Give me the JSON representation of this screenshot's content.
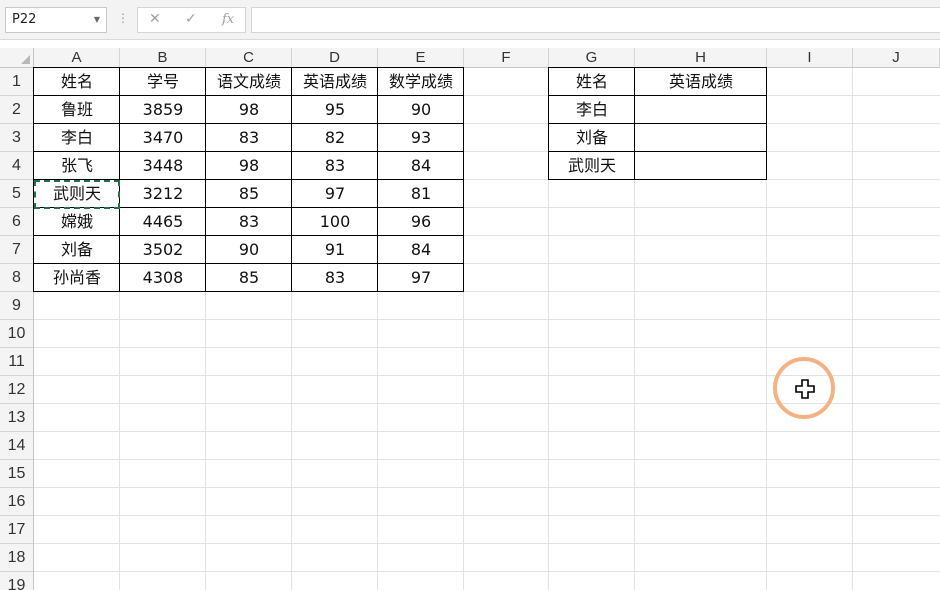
{
  "formula_bar": {
    "name_box": "P22",
    "cancel_glyph": "✕",
    "enter_glyph": "✓",
    "fx_label": "fx",
    "formula": ""
  },
  "columns": [
    "A",
    "B",
    "C",
    "D",
    "E",
    "F",
    "G",
    "H",
    "I",
    "J"
  ],
  "rows": [
    "1",
    "2",
    "3",
    "4",
    "5",
    "6",
    "7",
    "8",
    "9",
    "10",
    "11",
    "12",
    "13",
    "14",
    "15",
    "16",
    "17",
    "18",
    "19"
  ],
  "table1": {
    "headers": [
      "姓名",
      "学号",
      "语文成绩",
      "英语成绩",
      "数学成绩"
    ],
    "rows": [
      [
        "鲁班",
        "3859",
        "98",
        "95",
        "90"
      ],
      [
        "李白",
        "3470",
        "83",
        "82",
        "93"
      ],
      [
        "张飞",
        "3448",
        "98",
        "83",
        "84"
      ],
      [
        "武则天",
        "3212",
        "85",
        "97",
        "81"
      ],
      [
        "嫦娥",
        "4465",
        "83",
        "100",
        "96"
      ],
      [
        "刘备",
        "3502",
        "90",
        "91",
        "84"
      ],
      [
        "孙尚香",
        "4308",
        "85",
        "83",
        "97"
      ]
    ]
  },
  "table2": {
    "headers": [
      "姓名",
      "英语成绩"
    ],
    "rows": [
      [
        "李白",
        ""
      ],
      [
        "刘备",
        ""
      ],
      [
        "武则天",
        ""
      ]
    ]
  },
  "selection": {
    "name_box": "P22",
    "copy_marquee_cell": "A5"
  },
  "colors": {
    "marquee": "#217346",
    "cursor_ring": "#f4b183"
  },
  "icons": {
    "cursor": "crosshair-cursor-icon"
  }
}
